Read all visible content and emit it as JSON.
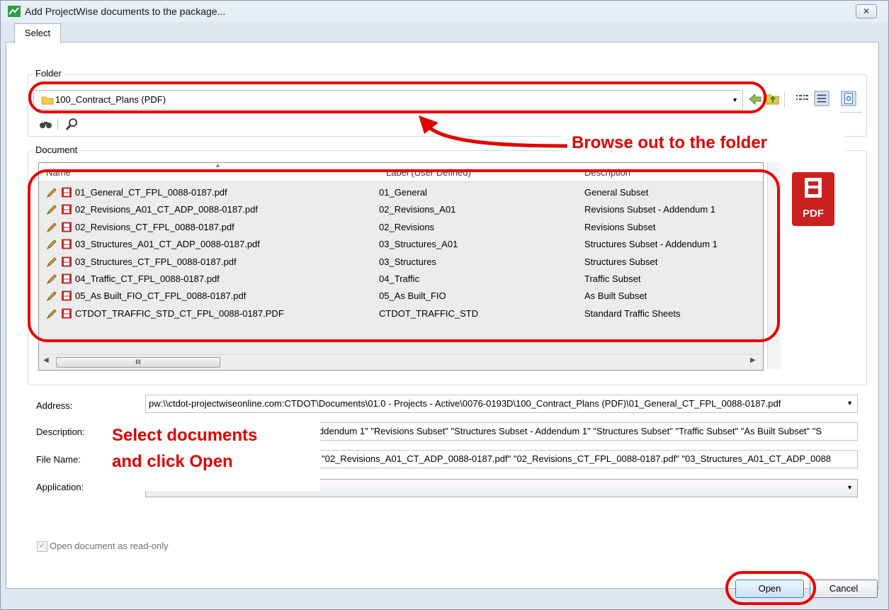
{
  "window": {
    "title": "Add ProjectWise documents to the package...",
    "close_glyph": "✕"
  },
  "tab": {
    "label": "Select"
  },
  "folder_group": {
    "label": "Folder",
    "current_folder": "100_Contract_Plans (PDF)"
  },
  "document_group": {
    "label": "Document"
  },
  "list": {
    "columns": [
      "Name",
      "Label (User Defined)",
      "Description"
    ],
    "rows": [
      {
        "name": "01_General_CT_FPL_0088-0187.pdf",
        "label": "01_General",
        "description": "General Subset"
      },
      {
        "name": "02_Revisions_A01_CT_ADP_0088-0187.pdf",
        "label": "02_Revisions_A01",
        "description": "Revisions Subset - Addendum 1"
      },
      {
        "name": "02_Revisions_CT_FPL_0088-0187.pdf",
        "label": "02_Revisions",
        "description": "Revisions Subset"
      },
      {
        "name": "03_Structures_A01_CT_ADP_0088-0187.pdf",
        "label": "03_Structures_A01",
        "description": "Structures Subset - Addendum 1"
      },
      {
        "name": "03_Structures_CT_FPL_0088-0187.pdf",
        "label": "03_Structures",
        "description": "Structures Subset"
      },
      {
        "name": "04_Traffic_CT_FPL_0088-0187.pdf",
        "label": "04_Traffic",
        "description": "Traffic Subset"
      },
      {
        "name": "05_As Built_FIO_CT_FPL_0088-0187.pdf",
        "label": "05_As Built_FIO",
        "description": "As Built Subset"
      },
      {
        "name": "CTDOT_TRAFFIC_STD_CT_FPL_0088-0187.PDF",
        "label": "CTDOT_TRAFFIC_STD",
        "description": "Standard Traffic Sheets"
      }
    ],
    "scroll_grip": "III"
  },
  "fields": {
    "address_label": "Address:",
    "address_value": "pw:\\\\ctdot-projectwiseonline.com:CTDOT\\Documents\\01.0 - Projects - Active\\0076-0193D\\100_Contract_Plans (PDF)\\01_General_CT_FPL_0088-0187.pdf",
    "description_label": "Description:",
    "description_value": "ddendum 1\" \"Revisions Subset\" \"Structures Subset - Addendum 1\" \"Structures Subset\" \"Traffic Subset\" \"As Built Subset\" \"S",
    "filename_label": "File Name:",
    "filename_value": "\"02_Revisions_A01_CT_ADP_0088-0187.pdf\" \"02_Revisions_CT_FPL_0088-0187.pdf\" \"03_Structures_A01_CT_ADP_0088",
    "application_label": "Application:",
    "readonly_label": "Open document as read-only"
  },
  "buttons": {
    "open": "Open",
    "cancel": "Cancel"
  },
  "annotations": {
    "browse": "Browse out to the folder",
    "select_line1": "Select documents",
    "select_line2": "and click Open",
    "color": "#e00000"
  },
  "pdf_badge": "PDF"
}
